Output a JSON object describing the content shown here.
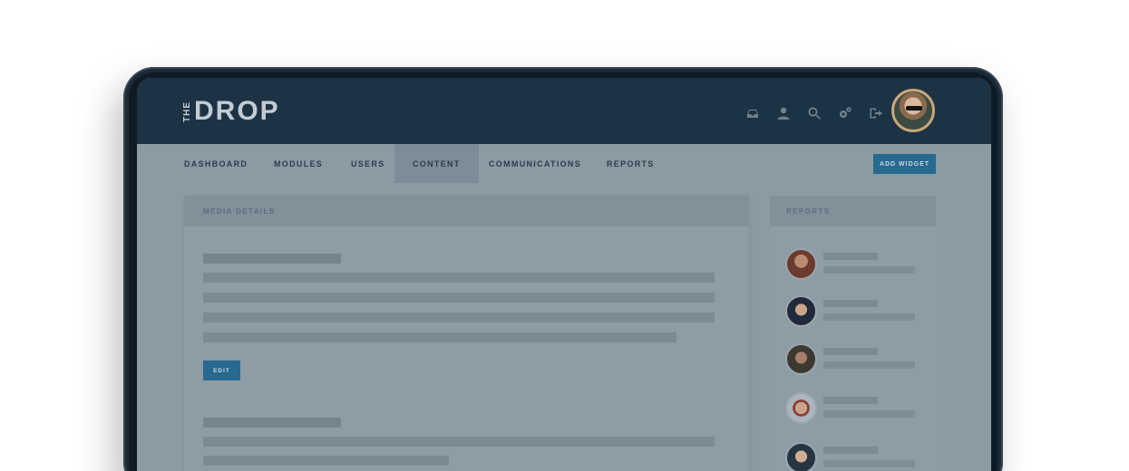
{
  "brand": {
    "the": "THE",
    "drop": "DROP"
  },
  "icons": [
    "inbox-icon",
    "user-icon",
    "search-icon",
    "settings-gears-icon",
    "logout-icon"
  ],
  "nav": {
    "items": [
      "DASHBOARD",
      "MODULES",
      "USERS",
      "CONTENT",
      "COMMUNICATIONS",
      "REPORTS"
    ],
    "active": "CONTENT",
    "add_widget": "ADD WIDGET"
  },
  "media_details": {
    "title": "MEDIA DETAILS",
    "edit_label": "EDIT"
  },
  "reports": {
    "title": "REPORTS",
    "count_visible": 5
  },
  "colors": {
    "header": "#1d3243",
    "accent": "#27698f",
    "overlay": "#8b9aa3"
  }
}
